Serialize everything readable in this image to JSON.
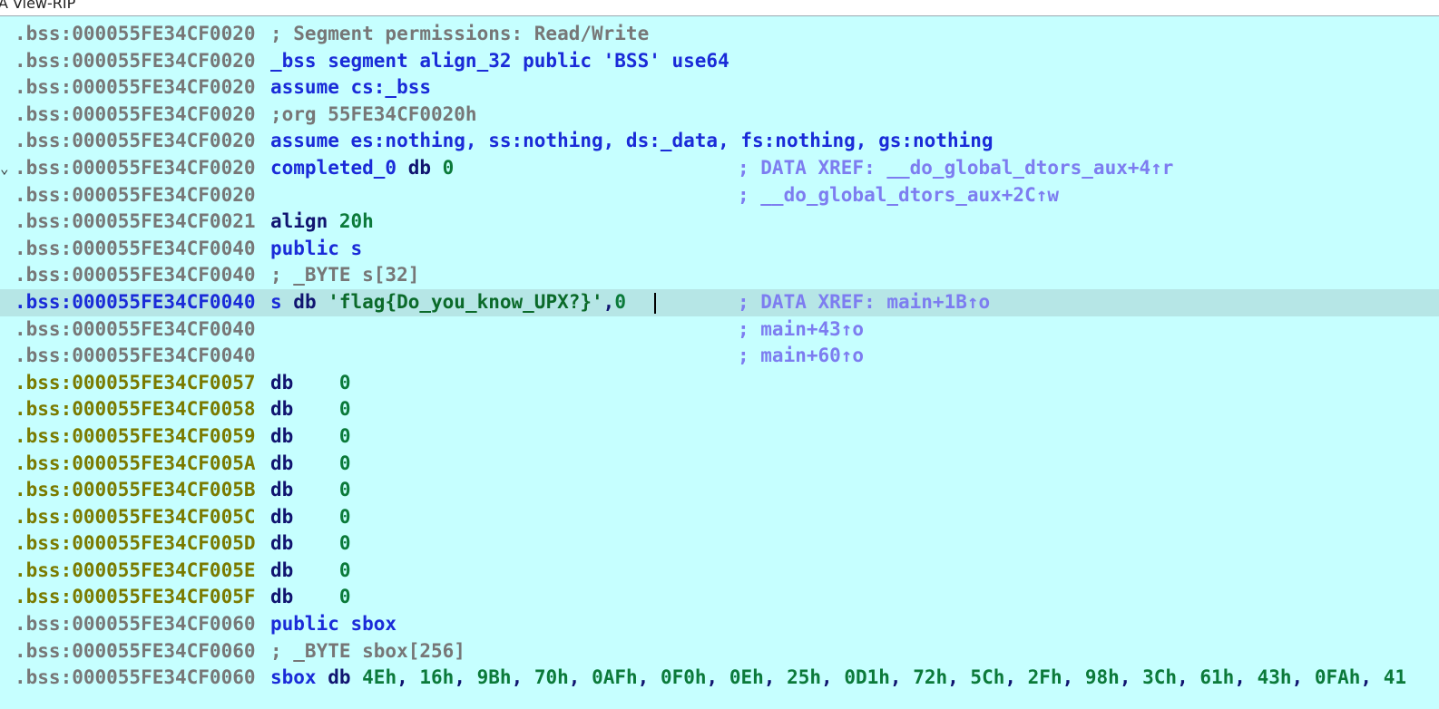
{
  "window": {
    "title": "A View-RIP"
  },
  "colors": {
    "background": "#c6ffff",
    "highlight_row": "#b6e6e6",
    "address_gray": "#777777",
    "address_olive": "#7a7a00",
    "keyword_blue": "#1a2bd8",
    "mnemonic_navy": "#101470",
    "number_green": "#0b7a3a",
    "comment_purple": "#7d7df0"
  },
  "rows": [
    {
      "addr": ".bss:000055FE34CF0020",
      "parts": [
        {
          "t": "; Segment permissions: Read/Write",
          "c": "gray"
        }
      ],
      "comment": ""
    },
    {
      "addr": ".bss:000055FE34CF0020",
      "parts": [
        {
          "t": "_bss segment align_32 public 'BSS' use64",
          "c": "blue"
        }
      ],
      "comment": ""
    },
    {
      "addr": ".bss:000055FE34CF0020",
      "parts": [
        {
          "t": "assume cs:_bss",
          "c": "blue"
        }
      ],
      "comment": ""
    },
    {
      "addr": ".bss:000055FE34CF0020",
      "parts": [
        {
          "t": ";org 55FE34CF0020h",
          "c": "gray"
        }
      ],
      "comment": ""
    },
    {
      "addr": ".bss:000055FE34CF0020",
      "parts": [
        {
          "t": "assume es:nothing, ss:nothing, ds:_data, fs:nothing, gs:nothing",
          "c": "blue"
        }
      ],
      "comment": ""
    },
    {
      "addr": ".bss:000055FE34CF0020",
      "fold": "⌄",
      "parts": [
        {
          "t": "completed_0 ",
          "c": "blue"
        },
        {
          "t": "db ",
          "c": "navy"
        },
        {
          "t": "0",
          "c": "green"
        }
      ],
      "comment": "; DATA XREF: __do_global_dtors_aux+4↑r"
    },
    {
      "addr": ".bss:000055FE34CF0020",
      "parts": [],
      "comment": "; __do_global_dtors_aux+2C↑w"
    },
    {
      "addr": ".bss:000055FE34CF0021",
      "parts": [
        {
          "t": "align ",
          "c": "navy"
        },
        {
          "t": "20h",
          "c": "green"
        }
      ],
      "comment": ""
    },
    {
      "addr": ".bss:000055FE34CF0040",
      "parts": [
        {
          "t": "public s",
          "c": "blue"
        }
      ],
      "comment": ""
    },
    {
      "addr": ".bss:000055FE34CF0040",
      "parts": [
        {
          "t": "; _BYTE s[32]",
          "c": "gray"
        }
      ],
      "comment": ""
    },
    {
      "addr": ".bss:000055FE34CF0040",
      "selected": true,
      "parts": [
        {
          "t": "s ",
          "c": "blue"
        },
        {
          "t": "db ",
          "c": "navy"
        },
        {
          "t": "'flag{Do_you_know_UPX?}'",
          "c": "str"
        },
        {
          "t": ",",
          "c": "navy"
        },
        {
          "t": "0",
          "c": "green"
        }
      ],
      "comment": "; DATA XREF: main+1B↑o"
    },
    {
      "addr": ".bss:000055FE34CF0040",
      "parts": [],
      "comment": "; main+43↑o"
    },
    {
      "addr": ".bss:000055FE34CF0040",
      "parts": [],
      "comment": "; main+60↑o"
    },
    {
      "addr": ".bss:000055FE34CF0057",
      "olive": true,
      "parts": [
        {
          "t": "db    ",
          "c": "navy"
        },
        {
          "t": "0",
          "c": "green"
        }
      ],
      "comment": ""
    },
    {
      "addr": ".bss:000055FE34CF0058",
      "olive": true,
      "parts": [
        {
          "t": "db    ",
          "c": "navy"
        },
        {
          "t": "0",
          "c": "green"
        }
      ],
      "comment": ""
    },
    {
      "addr": ".bss:000055FE34CF0059",
      "olive": true,
      "parts": [
        {
          "t": "db    ",
          "c": "navy"
        },
        {
          "t": "0",
          "c": "green"
        }
      ],
      "comment": ""
    },
    {
      "addr": ".bss:000055FE34CF005A",
      "olive": true,
      "parts": [
        {
          "t": "db    ",
          "c": "navy"
        },
        {
          "t": "0",
          "c": "green"
        }
      ],
      "comment": ""
    },
    {
      "addr": ".bss:000055FE34CF005B",
      "olive": true,
      "parts": [
        {
          "t": "db    ",
          "c": "navy"
        },
        {
          "t": "0",
          "c": "green"
        }
      ],
      "comment": ""
    },
    {
      "addr": ".bss:000055FE34CF005C",
      "olive": true,
      "parts": [
        {
          "t": "db    ",
          "c": "navy"
        },
        {
          "t": "0",
          "c": "green"
        }
      ],
      "comment": ""
    },
    {
      "addr": ".bss:000055FE34CF005D",
      "olive": true,
      "parts": [
        {
          "t": "db    ",
          "c": "navy"
        },
        {
          "t": "0",
          "c": "green"
        }
      ],
      "comment": ""
    },
    {
      "addr": ".bss:000055FE34CF005E",
      "olive": true,
      "parts": [
        {
          "t": "db    ",
          "c": "navy"
        },
        {
          "t": "0",
          "c": "green"
        }
      ],
      "comment": ""
    },
    {
      "addr": ".bss:000055FE34CF005F",
      "olive": true,
      "parts": [
        {
          "t": "db    ",
          "c": "navy"
        },
        {
          "t": "0",
          "c": "green"
        }
      ],
      "comment": ""
    },
    {
      "addr": ".bss:000055FE34CF0060",
      "parts": [
        {
          "t": "public sbox",
          "c": "blue"
        }
      ],
      "comment": ""
    },
    {
      "addr": ".bss:000055FE34CF0060",
      "parts": [
        {
          "t": "; _BYTE sbox[256]",
          "c": "gray"
        }
      ],
      "comment": ""
    },
    {
      "addr": ".bss:000055FE34CF0060",
      "parts": [
        {
          "t": "sbox ",
          "c": "blue"
        },
        {
          "t": "db ",
          "c": "navy"
        },
        {
          "t": "4Eh",
          "c": "green"
        },
        {
          "t": ", ",
          "c": "navy"
        },
        {
          "t": "16h",
          "c": "green"
        },
        {
          "t": ", ",
          "c": "navy"
        },
        {
          "t": "9Bh",
          "c": "green"
        },
        {
          "t": ", ",
          "c": "navy"
        },
        {
          "t": "70h",
          "c": "green"
        },
        {
          "t": ", ",
          "c": "navy"
        },
        {
          "t": "0AFh",
          "c": "green"
        },
        {
          "t": ", ",
          "c": "navy"
        },
        {
          "t": "0F0h",
          "c": "green"
        },
        {
          "t": ", ",
          "c": "navy"
        },
        {
          "t": "0Eh",
          "c": "green"
        },
        {
          "t": ", ",
          "c": "navy"
        },
        {
          "t": "25h",
          "c": "green"
        },
        {
          "t": ", ",
          "c": "navy"
        },
        {
          "t": "0D1h",
          "c": "green"
        },
        {
          "t": ", ",
          "c": "navy"
        },
        {
          "t": "72h",
          "c": "green"
        },
        {
          "t": ", ",
          "c": "navy"
        },
        {
          "t": "5Ch",
          "c": "green"
        },
        {
          "t": ", ",
          "c": "navy"
        },
        {
          "t": "2Fh",
          "c": "green"
        },
        {
          "t": ", ",
          "c": "navy"
        },
        {
          "t": "98h",
          "c": "green"
        },
        {
          "t": ", ",
          "c": "navy"
        },
        {
          "t": "3Ch",
          "c": "green"
        },
        {
          "t": ", ",
          "c": "navy"
        },
        {
          "t": "61h",
          "c": "green"
        },
        {
          "t": ", ",
          "c": "navy"
        },
        {
          "t": "43h",
          "c": "green"
        },
        {
          "t": ", ",
          "c": "navy"
        },
        {
          "t": "0FAh",
          "c": "green"
        },
        {
          "t": ", ",
          "c": "navy"
        },
        {
          "t": "41",
          "c": "green"
        }
      ],
      "comment": ""
    }
  ]
}
